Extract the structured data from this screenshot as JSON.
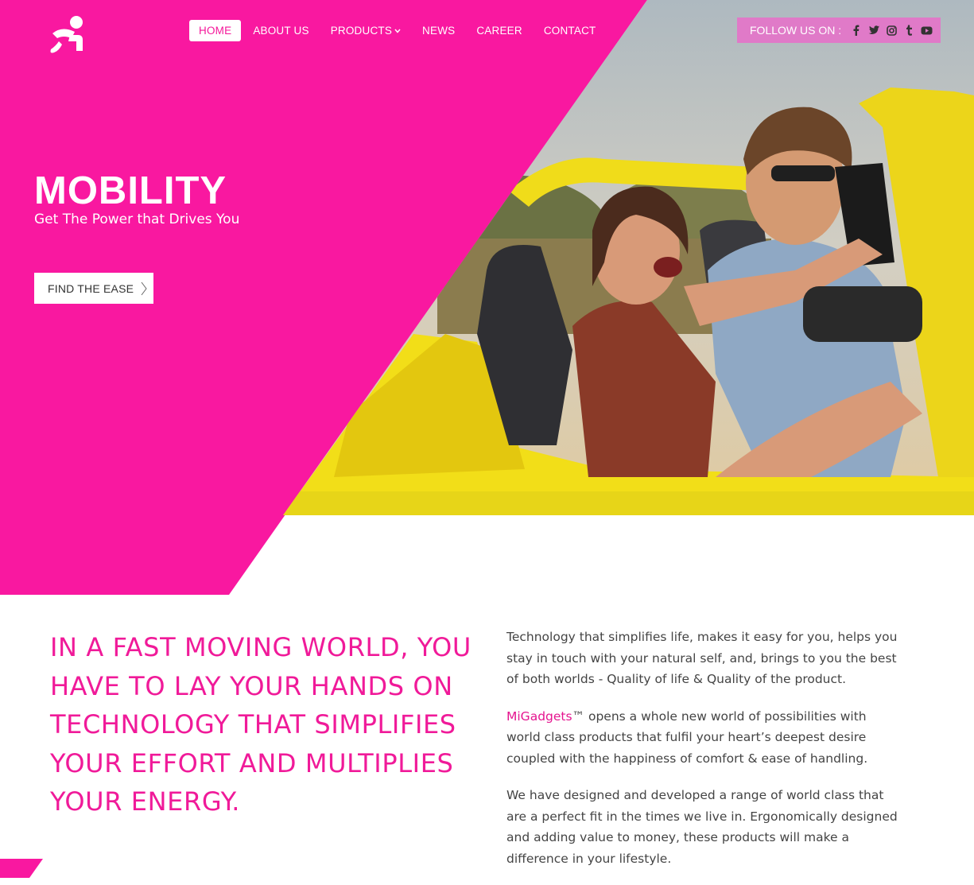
{
  "nav": {
    "items": [
      {
        "label": "HOME",
        "active": true
      },
      {
        "label": "ABOUT US"
      },
      {
        "label": "PRODUCTS",
        "has_dropdown": true
      },
      {
        "label": "NEWS"
      },
      {
        "label": "CAREER"
      },
      {
        "label": "CONTACT"
      }
    ],
    "dropdown_icon": "chevron-down-icon"
  },
  "follow": {
    "label": "FOLLOW US ON :",
    "icons": [
      "facebook-icon",
      "twitter-icon",
      "instagram-icon",
      "tumblr-icon",
      "youtube-icon"
    ]
  },
  "hero": {
    "title": "MOBILITY",
    "subtitle": "Get The Power that Drives You",
    "cta_label": "FIND THE EASE",
    "cta_icon": "chevron-right-icon",
    "photo": "couple-in-yellow-jeep-photo"
  },
  "content": {
    "headline": "IN A FAST MOVING WORLD, YOU HAVE TO LAY YOUR HANDS ON TECHNOLOGY THAT SIMPLIFIES YOUR EFFORT AND MULTIPLIES YOUR ENERGY.",
    "paragraph1": "Technology that simplifies life, makes it easy for you, helps you stay in touch with your natural self, and, brings to you the best of both worlds - Quality of life & Quality of the product.",
    "brand": "MiGadgets",
    "paragraph2_rest": "™ opens a whole new world of possibilities with world class products that fulfil your heart’s deepest desire coupled with the happiness of comfort & ease of handling.",
    "paragraph3": "We have designed and developed a range of world class that are a perfect fit in the times we live in. Ergonomically designed and adding value to money, these products will make a difference in your lifestyle."
  },
  "colors": {
    "brand_pink": "#f918a0",
    "follow_bg": "#e07ac8",
    "headline": "#f01a99",
    "body_text": "#444444",
    "jeep_yellow": "#f2de18"
  }
}
